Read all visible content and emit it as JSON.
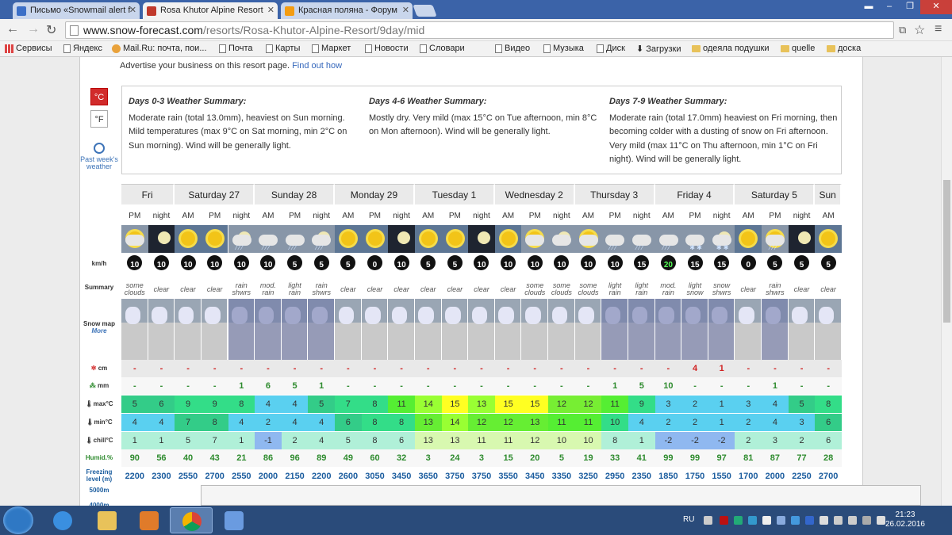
{
  "browser": {
    "tabs": [
      {
        "label": "Письмо «Snowmail alert f",
        "icon": "mail-icon",
        "color": "#3b6fc7",
        "active": false
      },
      {
        "label": "Rosa Khutor Alpine Resort",
        "icon": "snowflake-icon",
        "color": "#c0392b",
        "active": true
      },
      {
        "label": "Красная поляна - Форум",
        "icon": "forum-icon",
        "color": "#f39c12",
        "active": false
      }
    ],
    "url_host": "www.snow-forecast.com",
    "url_path": "/resorts/Rosa-Khutor-Alpine-Resort/9day/mid",
    "bookmarks": [
      {
        "label": "Сервисы",
        "icon": "apps-icon"
      },
      {
        "label": "Яндекс",
        "icon": "page-icon"
      },
      {
        "label": "Mail.Ru: почта, пои...",
        "icon": "mailru-icon"
      },
      {
        "label": "Почта",
        "icon": "page-icon"
      },
      {
        "label": "Карты",
        "icon": "page-icon"
      },
      {
        "label": "Маркет",
        "icon": "page-icon"
      },
      {
        "label": "Новости",
        "icon": "page-icon"
      },
      {
        "label": "Словари",
        "icon": "page-icon"
      },
      {
        "label": "Видео",
        "icon": "page-icon"
      },
      {
        "label": "Музыка",
        "icon": "page-icon"
      },
      {
        "label": "Диск",
        "icon": "page-icon"
      },
      {
        "label": "Загрузки",
        "icon": "download-icon"
      },
      {
        "label": "одеяла подушки",
        "icon": "folder-icon"
      },
      {
        "label": "quelle",
        "icon": "folder-icon"
      },
      {
        "label": "доска",
        "icon": "folder-icon"
      }
    ]
  },
  "page": {
    "advert_text": "Advertise your business on this resort page.",
    "advert_link": "Find out how",
    "unit_c": "°C",
    "unit_f": "°F",
    "past_week": "Past week's weather",
    "summaries": [
      {
        "title": "Days 0-3 Weather Summary:",
        "text": "Moderate rain (total 13.0mm), heaviest on Sun morning. Mild temperatures (max 9°C on Sat morning, min 2°C on Sun morning). Wind will be generally light."
      },
      {
        "title": "Days 4-6 Weather Summary:",
        "text": "Mostly dry. Very mild (max 15°C on Tue afternoon, min 8°C on Mon afternoon). Wind will be generally light."
      },
      {
        "title": "Days 7-9 Weather Summary:",
        "text": "Moderate rain (total 17.0mm) heaviest on Fri morning, then becoming colder with a dusting of snow on Fri afternoon. Very mild (max 11°C on Thu afternoon, min 1°C on Fri night). Wind will be generally light."
      }
    ],
    "row_labels": {
      "wind": "km/h",
      "summary": "Summary",
      "snow_map": "Snow map",
      "snow_more": "More",
      "snow": "cm",
      "rain": "mm",
      "max": "max°C",
      "min": "min°C",
      "chill": "chill°C",
      "humid": "Humid.%",
      "freezing": "Freezing level (m)",
      "alt1": "5000m",
      "alt2": "4000m"
    },
    "days": [
      {
        "name": "Fri",
        "slots": 2
      },
      {
        "name": "Saturday 27",
        "slots": 3
      },
      {
        "name": "Sunday 28",
        "slots": 3
      },
      {
        "name": "Monday 29",
        "slots": 3
      },
      {
        "name": "Tuesday 1",
        "slots": 3
      },
      {
        "name": "Wednesday 2",
        "slots": 3
      },
      {
        "name": "Thursday 3",
        "slots": 3
      },
      {
        "name": "Friday 4",
        "slots": 3
      },
      {
        "name": "Saturday 5",
        "slots": 3
      },
      {
        "name": "Sun",
        "slots": 1
      }
    ],
    "slots": [
      {
        "p": "PM",
        "ic": "sun-cloud",
        "w": "10",
        "s": "some clouds",
        "snow": "-",
        "rain": "-",
        "max": "5",
        "min": "4",
        "chill": "1",
        "hum": "90",
        "fl": "2200",
        "c": "#33cc88",
        "cm": "#5ad0f0",
        "cc": "#b0f0d8"
      },
      {
        "p": "night",
        "ic": "moon",
        "w": "10",
        "s": "clear",
        "snow": "-",
        "rain": "-",
        "max": "6",
        "min": "4",
        "chill": "1",
        "hum": "56",
        "fl": "2300",
        "c": "#33cc88",
        "cm": "#5ad0f0",
        "cc": "#b0f0d8"
      },
      {
        "p": "AM",
        "ic": "sun",
        "w": "10",
        "s": "clear",
        "snow": "-",
        "rain": "-",
        "max": "9",
        "min": "7",
        "chill": "5",
        "hum": "40",
        "fl": "2550",
        "c": "#33dd88",
        "cm": "#33cc88",
        "cc": "#b0f0d8"
      },
      {
        "p": "PM",
        "ic": "sun",
        "w": "10",
        "s": "clear",
        "snow": "-",
        "rain": "-",
        "max": "9",
        "min": "8",
        "chill": "7",
        "hum": "43",
        "fl": "2700",
        "c": "#33dd88",
        "cm": "#33cc88",
        "cc": "#b0f0d8"
      },
      {
        "p": "night",
        "ic": "moon-rain",
        "w": "10",
        "s": "rain shwrs",
        "snow": "-",
        "rain": "1",
        "max": "8",
        "min": "4",
        "chill": "1",
        "hum": "21",
        "fl": "2550",
        "c": "#33dd88",
        "cm": "#5ad0f0",
        "cc": "#b0f0d8"
      },
      {
        "p": "AM",
        "ic": "mod-rain",
        "w": "10",
        "s": "mod. rain",
        "snow": "-",
        "rain": "6",
        "max": "4",
        "min": "2",
        "chill": "-1",
        "hum": "86",
        "fl": "2000",
        "c": "#5ad0f0",
        "cm": "#5ad0f0",
        "cc": "#8fb8f0"
      },
      {
        "p": "PM",
        "ic": "light-rain",
        "w": "5",
        "s": "light rain",
        "snow": "-",
        "rain": "5",
        "max": "4",
        "min": "4",
        "chill": "2",
        "hum": "96",
        "fl": "2150",
        "c": "#5ad0f0",
        "cm": "#5ad0f0",
        "cc": "#b0f0d8"
      },
      {
        "p": "night",
        "ic": "moon-rain",
        "w": "5",
        "s": "rain shwrs",
        "snow": "-",
        "rain": "1",
        "max": "5",
        "min": "4",
        "chill": "4",
        "hum": "89",
        "fl": "2200",
        "c": "#33cc88",
        "cm": "#5ad0f0",
        "cc": "#b0f0d8"
      },
      {
        "p": "AM",
        "ic": "sun",
        "w": "5",
        "s": "clear",
        "snow": "-",
        "rain": "-",
        "max": "7",
        "min": "6",
        "chill": "5",
        "hum": "49",
        "fl": "2600",
        "c": "#33dd88",
        "cm": "#33cc88",
        "cc": "#b0f0d8"
      },
      {
        "p": "PM",
        "ic": "sun",
        "w": "0",
        "s": "clear",
        "snow": "-",
        "rain": "-",
        "max": "8",
        "min": "8",
        "chill": "8",
        "hum": "60",
        "fl": "3050",
        "c": "#33dd88",
        "cm": "#33dd88",
        "cc": "#b0f0d8"
      },
      {
        "p": "night",
        "ic": "moon",
        "w": "10",
        "s": "clear",
        "snow": "-",
        "rain": "-",
        "max": "11",
        "min": "8",
        "chill": "6",
        "hum": "32",
        "fl": "3450",
        "c": "#55ee33",
        "cm": "#33dd88",
        "cc": "#b0f0d8"
      },
      {
        "p": "AM",
        "ic": "sun",
        "w": "5",
        "s": "clear",
        "snow": "-",
        "rain": "-",
        "max": "14",
        "min": "13",
        "chill": "13",
        "hum": "3",
        "fl": "3650",
        "c": "#99ff33",
        "cm": "#66ee33",
        "cc": "#d8f8b0"
      },
      {
        "p": "PM",
        "ic": "sun",
        "w": "5",
        "s": "clear",
        "snow": "-",
        "rain": "-",
        "max": "15",
        "min": "14",
        "chill": "13",
        "hum": "24",
        "fl": "3750",
        "c": "#ffff22",
        "cm": "#99ff33",
        "cc": "#d8f8b0"
      },
      {
        "p": "night",
        "ic": "moon",
        "w": "10",
        "s": "clear",
        "snow": "-",
        "rain": "-",
        "max": "13",
        "min": "12",
        "chill": "11",
        "hum": "3",
        "fl": "3750",
        "c": "#99ff33",
        "cm": "#66ee33",
        "cc": "#d8f8b0"
      },
      {
        "p": "AM",
        "ic": "sun",
        "w": "10",
        "s": "clear",
        "snow": "-",
        "rain": "-",
        "max": "15",
        "min": "12",
        "chill": "11",
        "hum": "15",
        "fl": "3550",
        "c": "#ffff22",
        "cm": "#66ee33",
        "cc": "#d8f8b0"
      },
      {
        "p": "PM",
        "ic": "sun-cloud",
        "w": "10",
        "s": "some clouds",
        "snow": "-",
        "rain": "-",
        "max": "15",
        "min": "13",
        "chill": "12",
        "hum": "20",
        "fl": "3450",
        "c": "#ffff22",
        "cm": "#66ee33",
        "cc": "#d8f8b0"
      },
      {
        "p": "night",
        "ic": "moon-cloud",
        "w": "10",
        "s": "some clouds",
        "snow": "-",
        "rain": "-",
        "max": "12",
        "min": "11",
        "chill": "10",
        "hum": "5",
        "fl": "3350",
        "c": "#77ee33",
        "cm": "#55ee33",
        "cc": "#d8f8b0"
      },
      {
        "p": "AM",
        "ic": "sun-cloud",
        "w": "10",
        "s": "some clouds",
        "snow": "-",
        "rain": "-",
        "max": "12",
        "min": "11",
        "chill": "10",
        "hum": "19",
        "fl": "3250",
        "c": "#77ee33",
        "cm": "#55ee33",
        "cc": "#d8f8b0"
      },
      {
        "p": "PM",
        "ic": "light-rain",
        "w": "10",
        "s": "light rain",
        "snow": "-",
        "rain": "1",
        "max": "11",
        "min": "10",
        "chill": "8",
        "hum": "33",
        "fl": "2950",
        "c": "#55ee33",
        "cm": "#33dd88",
        "cc": "#b0f0d8"
      },
      {
        "p": "night",
        "ic": "light-rain",
        "w": "15",
        "s": "light rain",
        "snow": "-",
        "rain": "5",
        "max": "9",
        "min": "4",
        "chill": "1",
        "hum": "41",
        "fl": "2350",
        "c": "#33dd88",
        "cm": "#5ad0f0",
        "cc": "#b0f0d8"
      },
      {
        "p": "AM",
        "ic": "mod-rain",
        "w": "20",
        "s": "mod. rain",
        "snow": "-",
        "rain": "10",
        "max": "3",
        "min": "2",
        "chill": "-2",
        "hum": "99",
        "fl": "1850",
        "c": "#5ad0f0",
        "cm": "#5ad0f0",
        "cc": "#8fb8f0"
      },
      {
        "p": "PM",
        "ic": "light-snow",
        "w": "15",
        "s": "light snow",
        "snow": "4",
        "rain": "-",
        "max": "2",
        "min": "2",
        "chill": "-2",
        "hum": "99",
        "fl": "1750",
        "c": "#5ad0f0",
        "cm": "#5ad0f0",
        "cc": "#8fb8f0"
      },
      {
        "p": "night",
        "ic": "moon-snow",
        "w": "15",
        "s": "snow shwrs",
        "snow": "1",
        "rain": "-",
        "max": "1",
        "min": "1",
        "chill": "-2",
        "hum": "97",
        "fl": "1550",
        "c": "#5ad0f0",
        "cm": "#5ad0f0",
        "cc": "#8fb8f0"
      },
      {
        "p": "AM",
        "ic": "sun",
        "w": "0",
        "s": "clear",
        "snow": "-",
        "rain": "-",
        "max": "3",
        "min": "2",
        "chill": "2",
        "hum": "81",
        "fl": "1700",
        "c": "#5ad0f0",
        "cm": "#5ad0f0",
        "cc": "#b0f0d8"
      },
      {
        "p": "PM",
        "ic": "sun-rain",
        "w": "5",
        "s": "rain shwrs",
        "snow": "-",
        "rain": "1",
        "max": "4",
        "min": "4",
        "chill": "3",
        "hum": "87",
        "fl": "2000",
        "c": "#5ad0f0",
        "cm": "#5ad0f0",
        "cc": "#b0f0d8"
      },
      {
        "p": "night",
        "ic": "moon",
        "w": "5",
        "s": "clear",
        "snow": "-",
        "rain": "-",
        "max": "5",
        "min": "3",
        "chill": "2",
        "hum": "77",
        "fl": "2250",
        "c": "#33cc88",
        "cm": "#5ad0f0",
        "cc": "#b0f0d8"
      },
      {
        "p": "AM",
        "ic": "sun",
        "w": "5",
        "s": "clear",
        "snow": "-",
        "rain": "-",
        "max": "8",
        "min": "6",
        "chill": "6",
        "hum": "28",
        "fl": "2700",
        "c": "#33dd88",
        "cm": "#33cc88",
        "cc": "#b0f0d8"
      }
    ]
  },
  "taskbar": {
    "lang": "RU",
    "time": "21:23",
    "date": "26.02.2016"
  }
}
